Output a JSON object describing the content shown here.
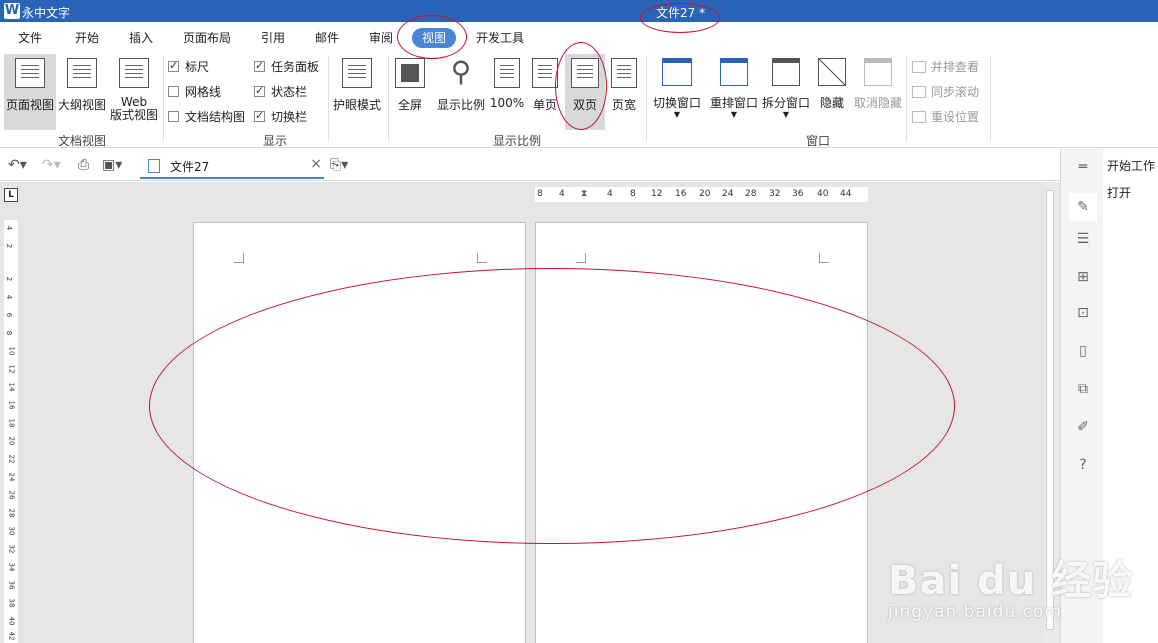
{
  "app": {
    "logo": "W",
    "name": "永中文字",
    "doc_title": "文件27 *"
  },
  "menu": [
    "文件",
    "开始",
    "插入",
    "页面布局",
    "引用",
    "邮件",
    "审阅",
    "视图",
    "开发工具"
  ],
  "ribbon": {
    "doc_view": {
      "page_view": "页面视图",
      "outline_view": "大纲视图",
      "web_view_1": "Web",
      "web_view_2": "版式视图",
      "label": "文档视图"
    },
    "display": {
      "ruler": "标尺",
      "task_pane": "任务面板",
      "gridlines": "网格线",
      "status_bar": "状态栏",
      "doc_structure": "文档结构图",
      "switch_bar": "切换栏",
      "label": "显示"
    },
    "eye_mode": "护眼模式",
    "zoom": {
      "full_screen": "全屏",
      "zoom_ratio": "显示比例",
      "hundred": "100%",
      "single_page": "单页",
      "double_page": "双页",
      "page_width": "页宽",
      "label": "显示比例"
    },
    "window": {
      "switch_window": "切换窗口",
      "rearrange_window": "重排窗口",
      "split_window": "拆分窗口",
      "hide": "隐藏",
      "unhide": "取消隐藏",
      "side_by_side": "并排查看",
      "sync_scroll": "同步滚动",
      "reset_position": "重设位置",
      "label": "窗口"
    }
  },
  "qabar": {
    "doc_tab": "文件27",
    "close": "×"
  },
  "ruler": {
    "corner": "L",
    "h_ticks": [
      "8",
      "4",
      "4",
      "8",
      "12",
      "16",
      "20",
      "24",
      "28",
      "32",
      "36",
      "40",
      "44"
    ],
    "v_ticks": [
      "4",
      "2",
      "2",
      "4",
      "6",
      "8",
      "10",
      "12",
      "14",
      "16",
      "18",
      "20",
      "22",
      "24",
      "26",
      "28",
      "30",
      "32",
      "34",
      "36",
      "38",
      "40",
      "42"
    ]
  },
  "taskpane": {
    "title": "开始工作",
    "open": "打开"
  },
  "watermark": {
    "main": "Bai du 经验",
    "sub": "jingyan.baidu.com"
  },
  "colors": {
    "accent": "#2a64b8",
    "tab_active": "#4a86d6",
    "annotation": "#c8102e"
  }
}
